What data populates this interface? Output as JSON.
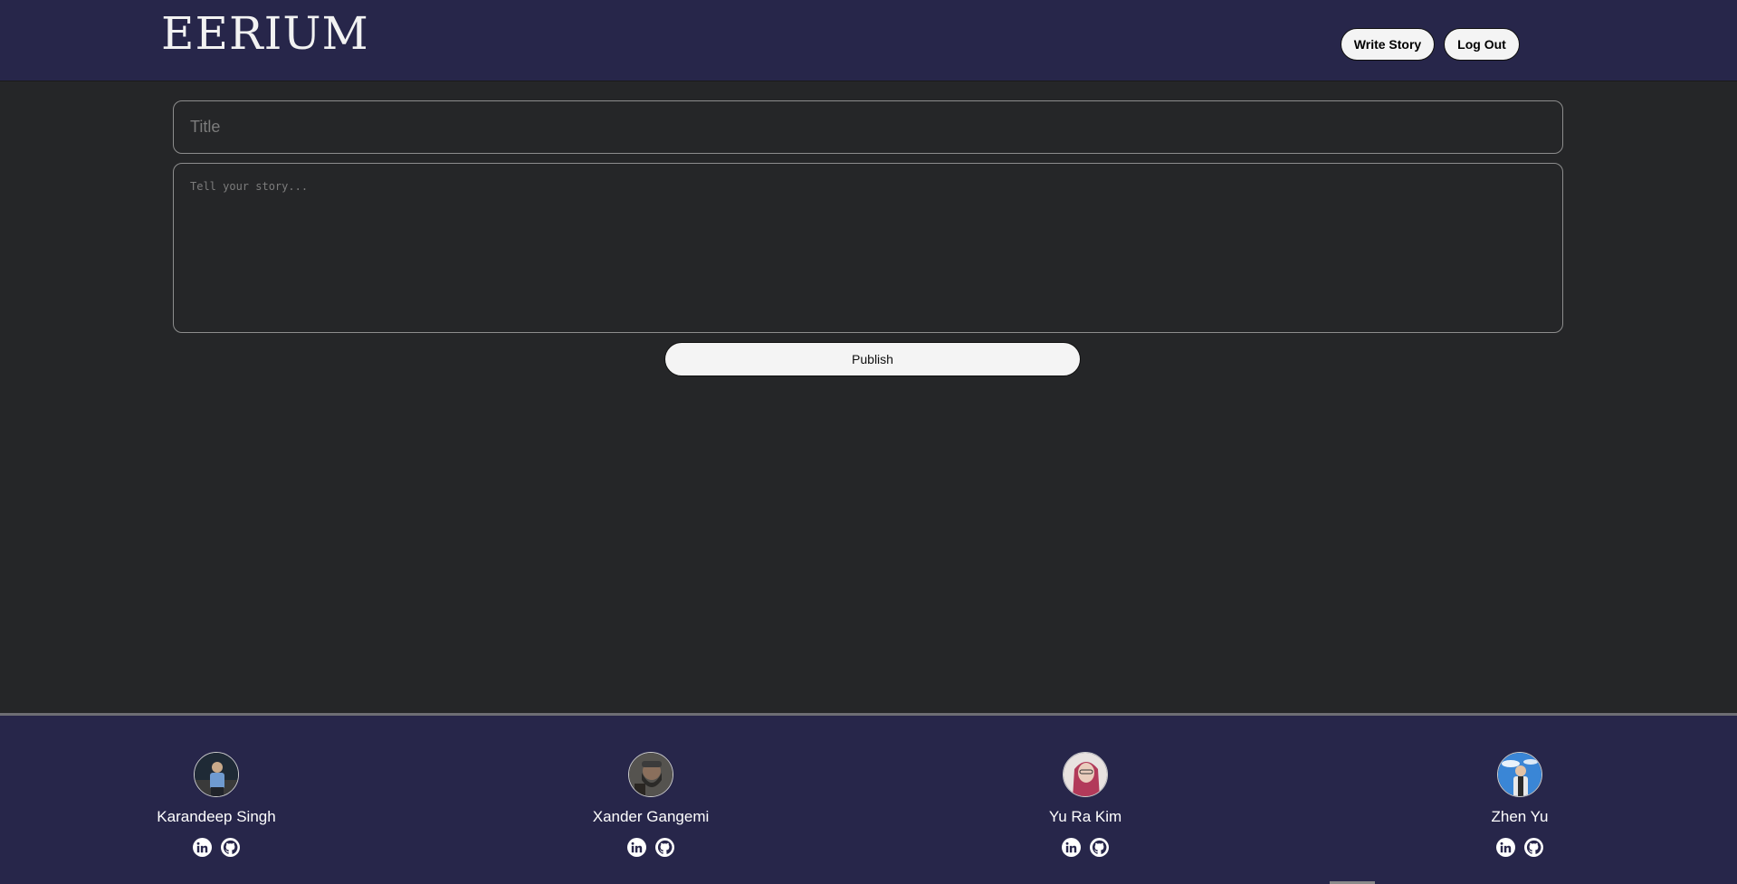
{
  "header": {
    "logo_text": "EERIUM",
    "write_story_label": "Write Story",
    "logout_label": "Log Out"
  },
  "form": {
    "title_placeholder": "Title",
    "story_placeholder": "Tell your story...",
    "publish_label": "Publish"
  },
  "footer": {
    "members": [
      {
        "name": "Karandeep Singh",
        "avatar_color": "#2d3a4a"
      },
      {
        "name": "Xander Gangemi",
        "avatar_color": "#4a4a48"
      },
      {
        "name": "Yu Ra Kim",
        "avatar_color": "#d9c7c2"
      },
      {
        "name": "Zhen Yu",
        "avatar_color": "#3a7ccf"
      }
    ],
    "social_icons": [
      "linkedin-icon",
      "github-icon"
    ]
  },
  "colors": {
    "header_bg": "#27264a",
    "body_bg": "#252628",
    "button_bg": "#f4f4f4"
  }
}
